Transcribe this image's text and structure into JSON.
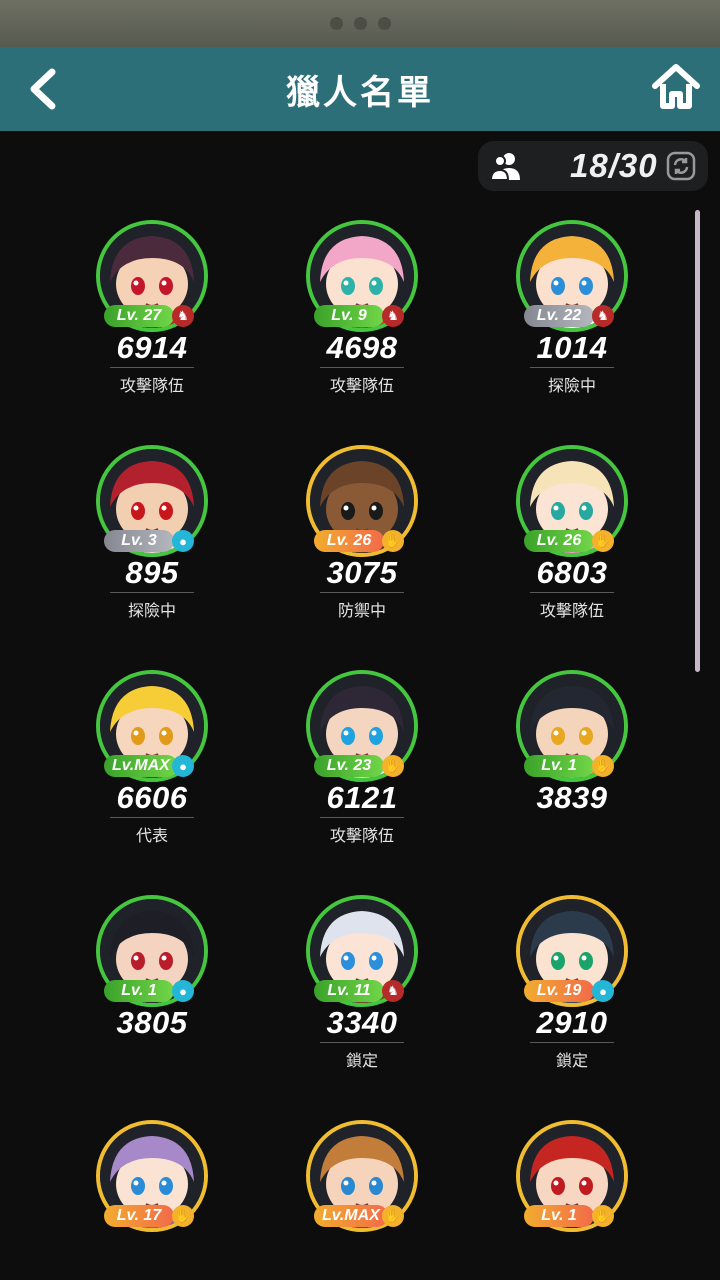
{
  "header": {
    "title": "獵人名單",
    "back_icon": "back-arrow-icon",
    "home_icon": "home-icon"
  },
  "roster": {
    "count": "18/30",
    "people_icon": "people-icon",
    "sync_icon": "sync-icon"
  },
  "hunters": [
    {
      "lv": "Lv. 27",
      "lv_color": "green",
      "element": "red",
      "power": "6914",
      "status": "攻擊隊伍",
      "hair": "#4b2a3c",
      "skin": "#f5d1b6",
      "eyes": "#c4162a",
      "accent": "#c8261f",
      "ring": "green"
    },
    {
      "lv": "Lv. 9",
      "lv_color": "green",
      "element": "red",
      "power": "4698",
      "status": "攻擊隊伍",
      "hair": "#f3a7c8",
      "skin": "#fbe1d0",
      "eyes": "#2db1a8",
      "accent": "#e23a3a",
      "ring": "green"
    },
    {
      "lv": "Lv. 22",
      "lv_color": "gray",
      "element": "red",
      "power": "1014",
      "status": "探險中",
      "hair": "#f4b23a",
      "skin": "#fbe1cd",
      "eyes": "#2a8fd8",
      "accent": "#ffffff",
      "ring": "green"
    },
    {
      "lv": "Lv. 3",
      "lv_color": "gray",
      "element": "cyan",
      "power": "895",
      "status": "探險中",
      "hair": "#b4212e",
      "skin": "#f3cfb2",
      "eyes": "#c8161d",
      "accent": "#e9e3d9",
      "ring": "green"
    },
    {
      "lv": "Lv. 26",
      "lv_color": "orange",
      "element": "yellow",
      "power": "3075",
      "status": "防禦中",
      "hair": "#6b4328",
      "skin": "#8a5a36",
      "eyes": "#1a1a1a",
      "accent": "#5b3a22",
      "ring": "gold"
    },
    {
      "lv": "Lv. 26",
      "lv_color": "green",
      "element": "yellow",
      "power": "6803",
      "status": "攻擊隊伍",
      "hair": "#f6e4b8",
      "skin": "#fbe4d3",
      "eyes": "#27a9a1",
      "accent": "#f1a8c1",
      "ring": "green"
    },
    {
      "lv": "Lv.MAX",
      "lv_color": "green",
      "element": "cyan",
      "power": "6606",
      "status": "代表",
      "hair": "#f7cd37",
      "skin": "#f6d7bd",
      "eyes": "#e29a19",
      "accent": "#2052a8",
      "ring": "green"
    },
    {
      "lv": "Lv. 23",
      "lv_color": "green",
      "element": "yellow",
      "power": "6121",
      "status": "攻擊隊伍",
      "hair": "#2d2736",
      "skin": "#f4d5c0",
      "eyes": "#1ea3e0",
      "accent": "#e8e8f0",
      "ring": "green"
    },
    {
      "lv": "Lv. 1",
      "lv_color": "green",
      "element": "yellow",
      "power": "3839",
      "status": "",
      "hair": "#232732",
      "skin": "#f4d4bb",
      "eyes": "#e7a81f",
      "accent": "#e59a2c",
      "ring": "green"
    },
    {
      "lv": "Lv. 1",
      "lv_color": "green",
      "element": "cyan",
      "power": "3805",
      "status": "",
      "hair": "#1d1e26",
      "skin": "#f4d4c0",
      "eyes": "#b91c2a",
      "accent": "#2c2d38",
      "ring": "green"
    },
    {
      "lv": "Lv. 11",
      "lv_color": "green",
      "element": "red",
      "power": "3340",
      "status": "鎖定",
      "hair": "#dfe3ee",
      "skin": "#fbe4d6",
      "eyes": "#2b8fdb",
      "accent": "#7a4a2c",
      "ring": "green"
    },
    {
      "lv": "Lv. 19",
      "lv_color": "orange",
      "element": "cyan",
      "power": "2910",
      "status": "鎖定",
      "hair": "#2c3b4c",
      "skin": "#fbe3d2",
      "eyes": "#1aa36b",
      "accent": "#3a4d61",
      "ring": "gold"
    },
    {
      "lv": "Lv. 17",
      "lv_color": "orange",
      "element": "yellow",
      "power": "",
      "status": "",
      "hair": "#a788c9",
      "skin": "#fbe3d3",
      "eyes": "#2a8bd6",
      "accent": "#8769ad",
      "ring": "gold"
    },
    {
      "lv": "Lv.MAX",
      "lv_color": "orange",
      "element": "yellow",
      "power": "",
      "status": "",
      "hair": "#c27d3a",
      "skin": "#f6d4bb",
      "eyes": "#2a88d1",
      "accent": "#3b6e3a",
      "ring": "gold"
    },
    {
      "lv": "Lv. 1",
      "lv_color": "orange",
      "element": "yellow",
      "power": "",
      "status": "",
      "hair": "#c62621",
      "skin": "#f7d7c2",
      "eyes": "#c11b22",
      "accent": "#2a2a2a",
      "ring": "gold"
    }
  ]
}
